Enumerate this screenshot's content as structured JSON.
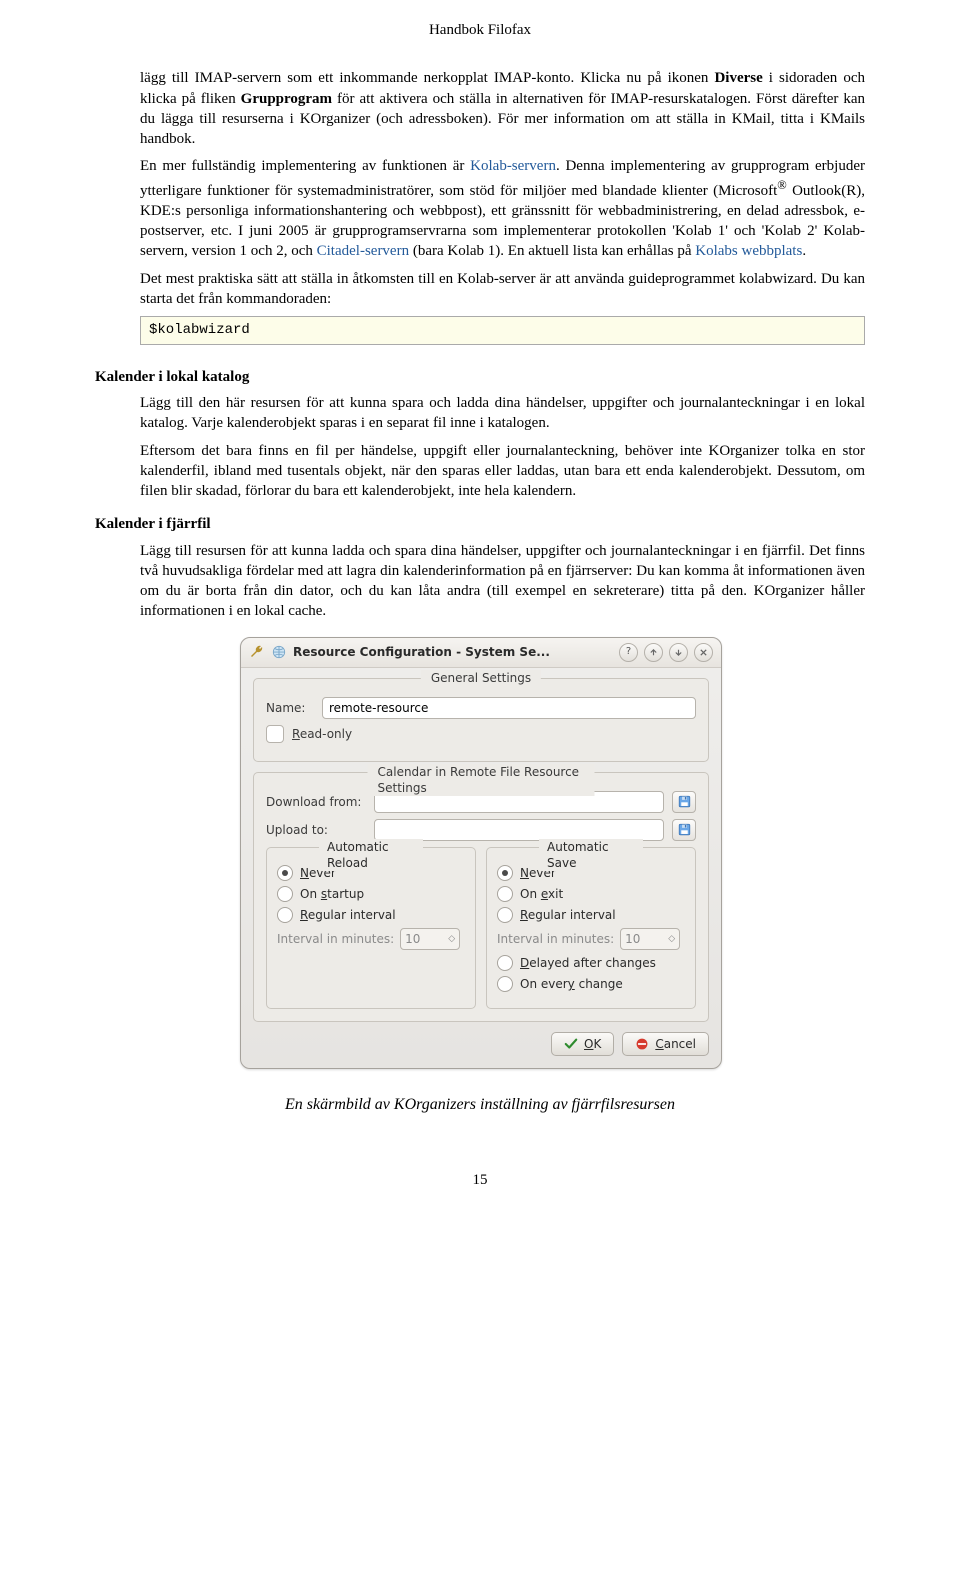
{
  "header": {
    "title": "Handbok Filofax"
  },
  "p1": {
    "t1": "lägg till IMAP-servern som ett inkommande nerkopplat IMAP-konto. Klicka nu på ikonen ",
    "b1": "Diverse",
    "t2": " i sidoraden och klicka på fliken ",
    "b2": "Grupprogram",
    "t3": " för att aktivera och ställa in alternativen för IMAP-resurskatalogen. Först därefter kan du lägga till resurserna i KOrganizer (och adressboken). För mer information om att ställa in KMail, titta i KMails handbok."
  },
  "p2": {
    "t1": "En mer fullständig implementering av funktionen är ",
    "link1": "Kolab-servern",
    "t2": ". Denna implementering av grupprogram erbjuder ytterligare funktioner för systemadministratörer, som stöd för miljöer med blandade klienter (Microsoft",
    "reg": "®",
    "t3": " Outlook(R), KDE:s personliga informationshantering och webbpost), ett gränssnitt för webbadministrering, en delad adressbok, e-postserver, etc. I juni 2005 är grupprogramservrarna som implementerar protokollen 'Kolab 1' och 'Kolab 2' Kolab-servern, version 1 och 2, och ",
    "link2": "Citadel-servern",
    "t4": " (bara Kolab 1). En aktuell lista kan erhållas på ",
    "link3": "Kolabs webbplats",
    "t5": "."
  },
  "p3": "Det mest praktiska sätt att ställa in åtkomsten till en Kolab-server är att använda guideprogrammet kolabwizard. Du kan starta det från kommandoraden:",
  "cmd": "$kolabwizard",
  "sec_local": {
    "heading": "Kalender i lokal katalog",
    "p1": "Lägg till den här resursen för att kunna spara och ladda dina händelser, uppgifter och journalanteckningar i en lokal katalog. Varje kalenderobjekt sparas i en separat fil inne i katalogen.",
    "p2": "Eftersom det bara finns en fil per händelse, uppgift eller journalanteckning, behöver inte KOrganizer tolka en stor kalenderfil, ibland med tusentals objekt, när den sparas eller laddas, utan bara ett enda kalenderobjekt. Dessutom, om filen blir skadad, förlorar du bara ett kalenderobjekt, inte hela kalendern."
  },
  "sec_remote": {
    "heading": "Kalender i fjärrfil",
    "p1": "Lägg till resursen för att kunna ladda och spara dina händelser, uppgifter och journalanteckningar i en fjärrfil. Det finns två huvudsakliga fördelar med att lagra din kalenderinformation på en fjärrserver: Du kan komma åt informationen även om du är borta från din dator, och du kan låta andra (till exempel en sekreterare) titta på den. KOrganizer håller informationen i en lokal cache."
  },
  "dialog": {
    "title": "Resource Configuration - System Se...",
    "general_group": "General Settings",
    "name_label": "Name:",
    "name_value": "remote-resource",
    "readonly_prefix": "R",
    "readonly_rest": "ead-only",
    "remote_group": "Calendar in Remote File Resource Settings",
    "download_label": "Download from:",
    "upload_label": "Upload to:",
    "auto_reload": {
      "title": "Automatic Reload",
      "never_prefix": "N",
      "never_rest": "ever",
      "startup_pre": "On ",
      "startup_u": "s",
      "startup_rest": "tartup",
      "regular_u": "R",
      "regular_rest": "egular interval",
      "interval_label": "Interval in minutes:",
      "interval_value": "10"
    },
    "auto_save": {
      "title": "Automatic Save",
      "never_prefix": "N",
      "never_rest": "ever",
      "exit_pre": "On ",
      "exit_u": "e",
      "exit_rest": "xit",
      "regular_u": "R",
      "regular_rest": "egular interval",
      "interval_label": "Interval in minutes:",
      "interval_value": "10",
      "delayed_u": "D",
      "delayed_rest": "elayed after changes",
      "every_pre": "On ever",
      "every_u": "y",
      "every_rest": " change"
    },
    "ok_label": "OK",
    "ok_u": "O",
    "ok_rest": "K",
    "cancel_u": "C",
    "cancel_rest": "ancel"
  },
  "caption": "En skärmbild av KOrganizers inställning av fjärrfilsresursen",
  "pagenum": "15"
}
